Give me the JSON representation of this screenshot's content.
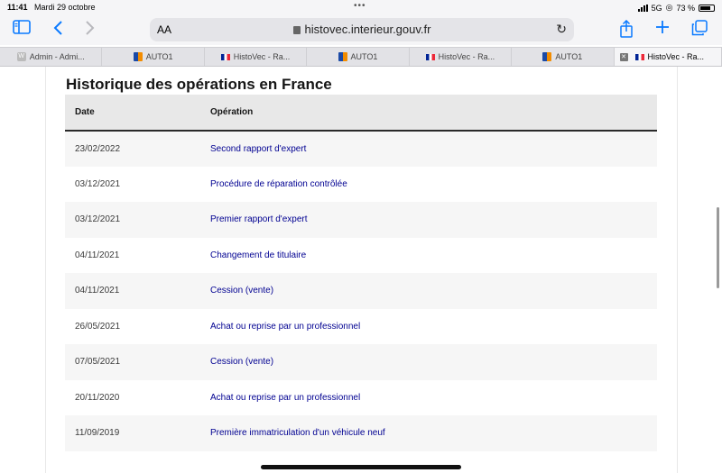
{
  "status": {
    "time": "11:41",
    "date": "Mardi 29 octobre",
    "network": "5G",
    "battery": "73 %",
    "battery_level": 0.73
  },
  "toolbar": {
    "text_size": "AA",
    "url": "histovec.interieur.gouv.fr"
  },
  "tabs": [
    {
      "label": "Admin - Admi...",
      "favicon": "w-favicon"
    },
    {
      "label": "AUTO1",
      "favicon": "auto1-favicon"
    },
    {
      "label": "HistoVec - Ra...",
      "favicon": "fr-flag-favicon"
    },
    {
      "label": "AUTO1",
      "favicon": "auto1-favicon"
    },
    {
      "label": "HistoVec - Ra...",
      "favicon": "fr-flag-favicon"
    },
    {
      "label": "AUTO1",
      "favicon": "auto1-favicon"
    },
    {
      "label": "HistoVec - Ra...",
      "favicon": "fr-flag-favicon",
      "active": true
    }
  ],
  "page": {
    "title": "Historique des opérations en France",
    "columns": {
      "date": "Date",
      "operation": "Opération"
    },
    "rows": [
      {
        "date": "23/02/2022",
        "operation": "Second rapport d'expert"
      },
      {
        "date": "03/12/2021",
        "operation": "Procédure de réparation contrôlée"
      },
      {
        "date": "03/12/2021",
        "operation": "Premier rapport d'expert"
      },
      {
        "date": "04/11/2021",
        "operation": "Changement de titulaire"
      },
      {
        "date": "04/11/2021",
        "operation": "Cession (vente)"
      },
      {
        "date": "26/05/2021",
        "operation": "Achat ou reprise par un professionnel"
      },
      {
        "date": "07/05/2021",
        "operation": "Cession (vente)"
      },
      {
        "date": "20/11/2020",
        "operation": "Achat ou reprise par un professionnel"
      },
      {
        "date": "11/09/2019",
        "operation": "Première immatriculation d'un véhicule neuf"
      }
    ]
  },
  "colors": {
    "link": "#000091",
    "accent": "#0a7aff"
  }
}
